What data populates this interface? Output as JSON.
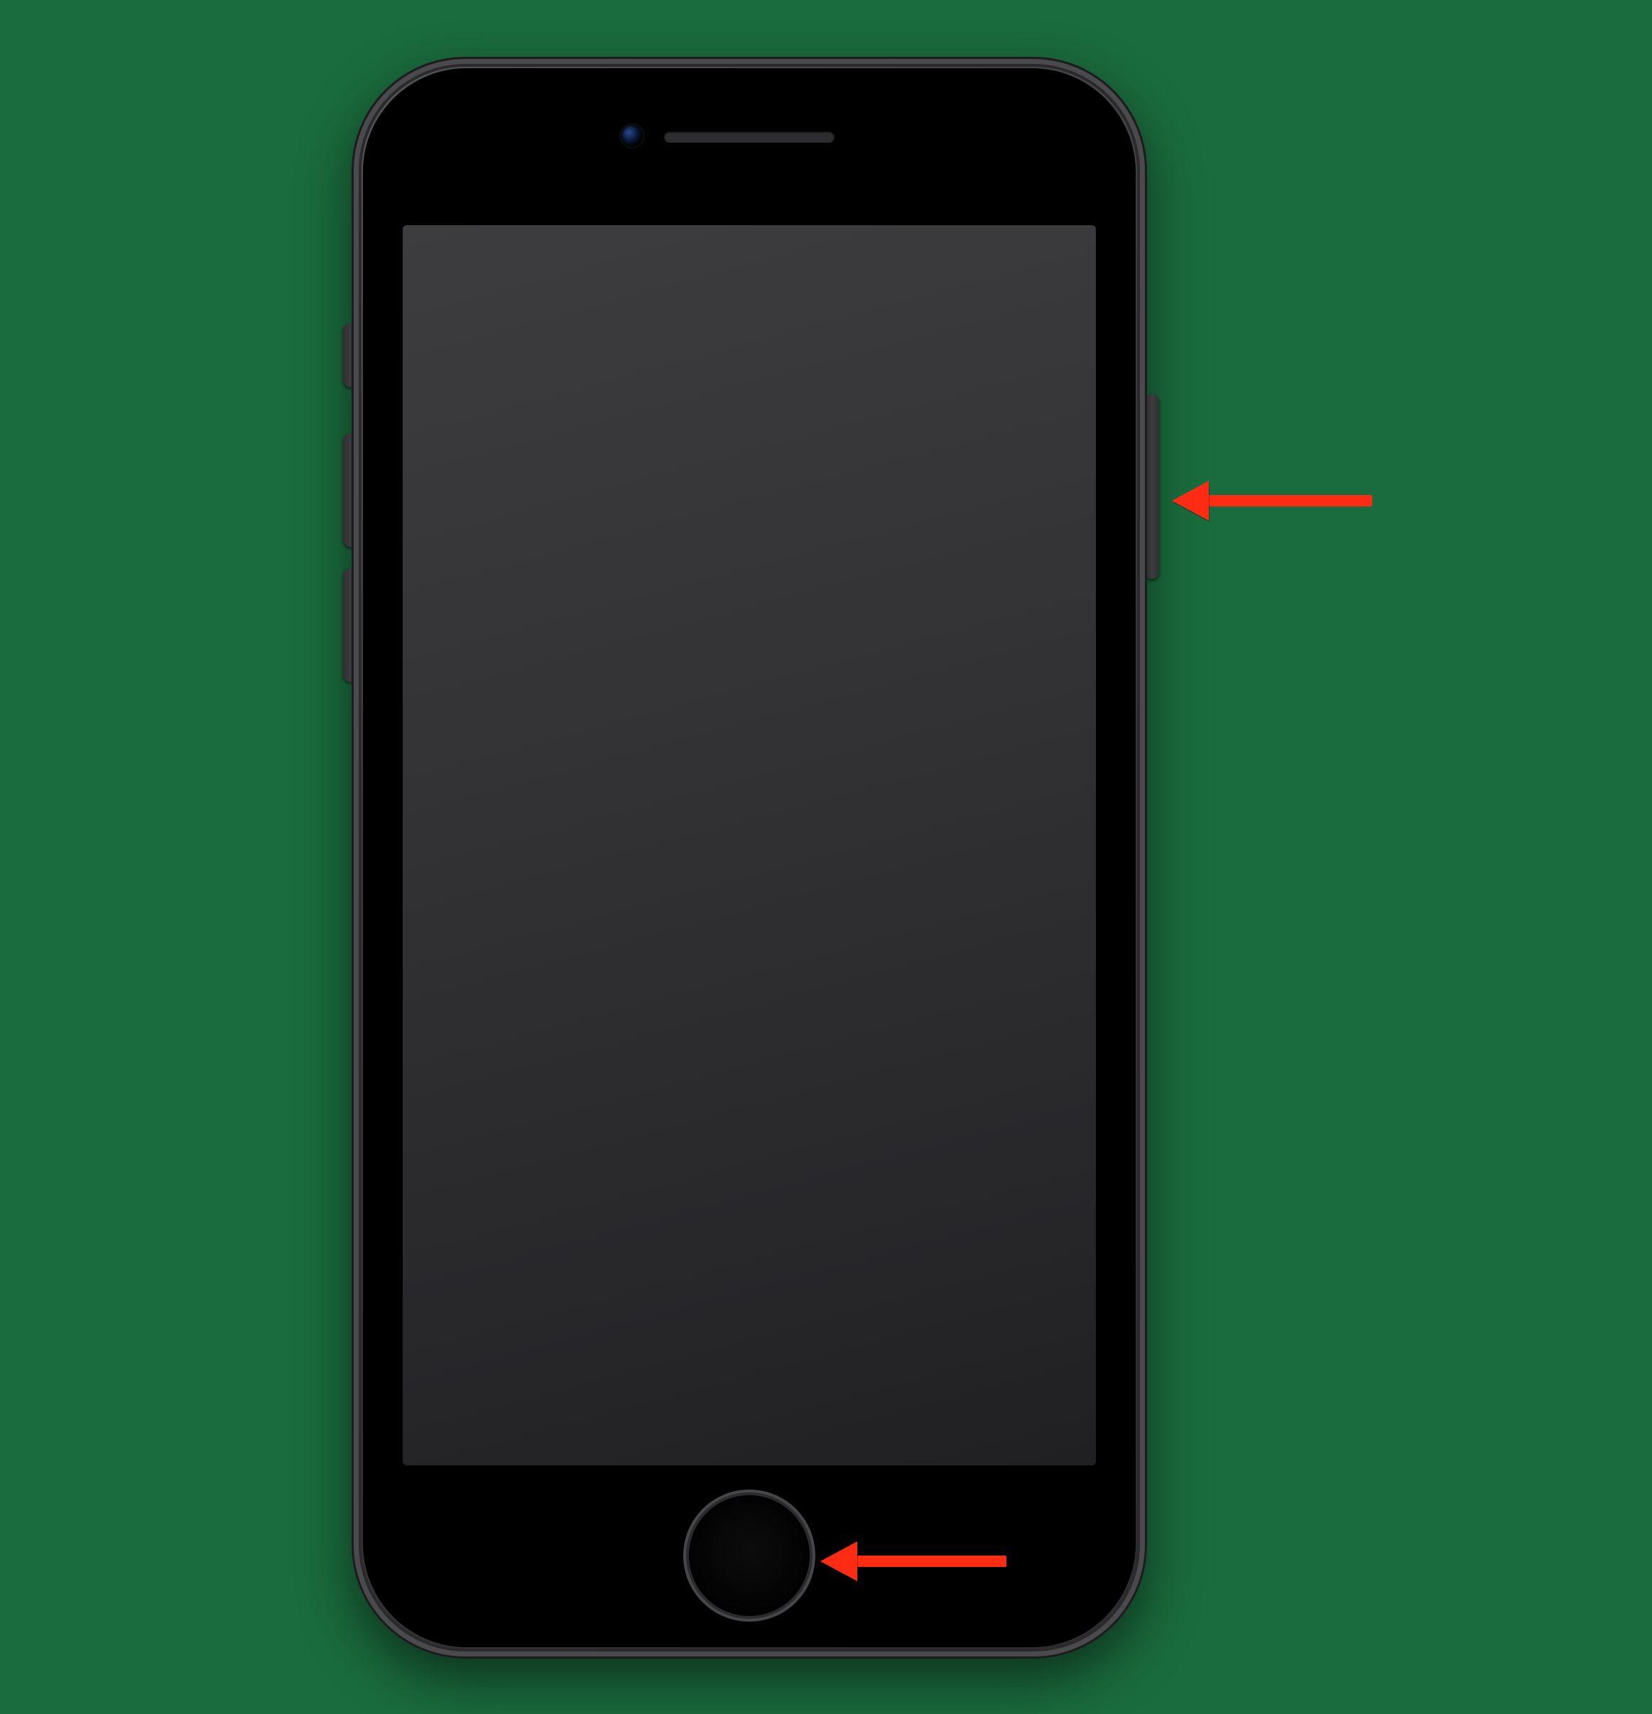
{
  "device": {
    "name": "iPhone (Home-button model)",
    "color": "Space Gray",
    "screen_state": "off"
  },
  "annotations": {
    "arrow_side_button": "Side button",
    "arrow_home_button": "Home button"
  },
  "colors": {
    "background": "#1a6b3d",
    "arrow": "#ff2b12",
    "body_metal": "#3b3b3e",
    "screen_off": "#2c2c2e"
  },
  "labels": {
    "ringer_switch": "Ring/Silent switch",
    "volume_up": "Volume Up",
    "volume_down": "Volume Down",
    "side_button": "Side button",
    "home_button": "Home button",
    "earpiece": "Earpiece speaker",
    "front_camera": "Front camera",
    "screen": "Display"
  }
}
